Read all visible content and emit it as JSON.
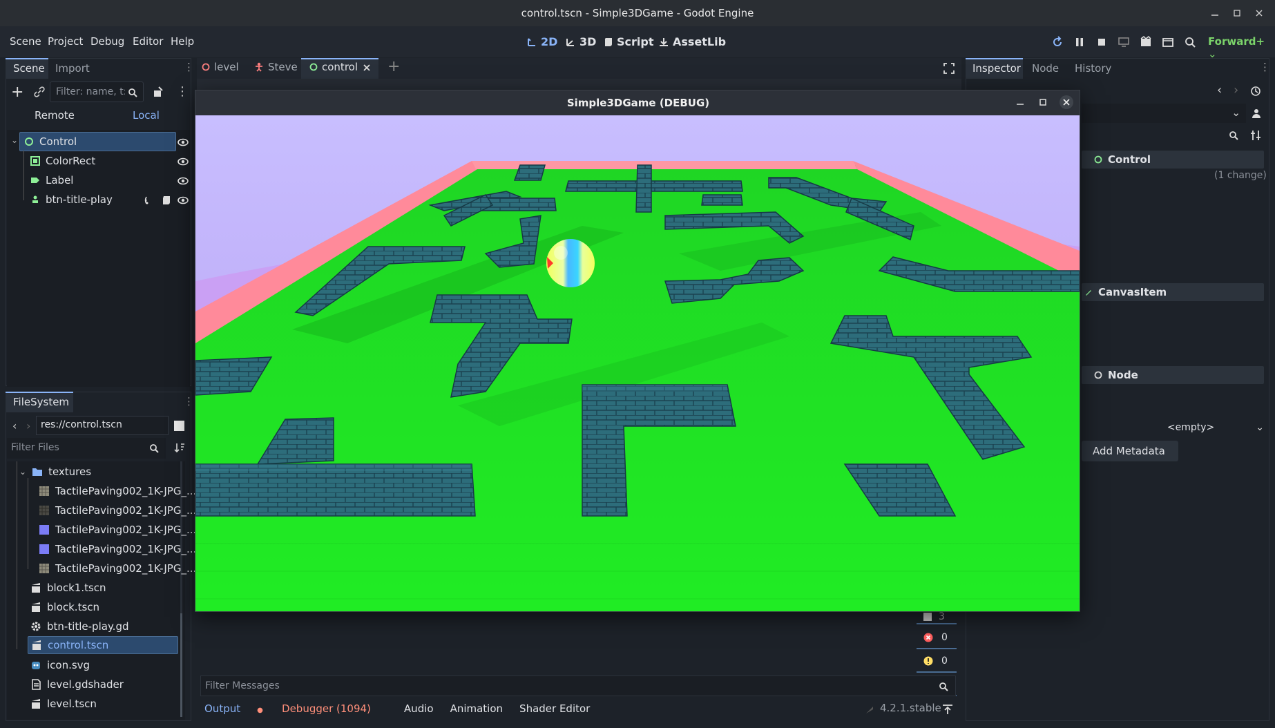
{
  "window": {
    "title": "control.tscn - Simple3DGame - Godot Engine"
  },
  "menu": [
    "Scene",
    "Project",
    "Debug",
    "Editor",
    "Help"
  ],
  "workspaces": [
    {
      "label": "2D",
      "icon": "2d-icon",
      "active": true
    },
    {
      "label": "3D",
      "icon": "3d-icon"
    },
    {
      "label": "Script",
      "icon": "script-icon"
    },
    {
      "label": "AssetLib",
      "icon": "assetlib-icon"
    }
  ],
  "renderer": "Forward+",
  "scene_dock": {
    "tabs": [
      "Scene",
      "Import"
    ],
    "filter_placeholder": "Filter: name, t:t",
    "remote": "Remote",
    "local": "Local",
    "nodes": [
      {
        "label": "Control",
        "icon": "control-icon",
        "selected": true
      },
      {
        "label": "ColorRect",
        "icon": "colorrect-icon"
      },
      {
        "label": "Label",
        "icon": "label-icon"
      },
      {
        "label": "btn-title-play",
        "icon": "button-icon"
      }
    ]
  },
  "filesystem": {
    "tab": "FileSystem",
    "path": "res://control.tscn",
    "filter_placeholder": "Filter Files",
    "items": [
      {
        "label": "textures",
        "type": "folder"
      },
      {
        "label": "TactilePaving002_1K-JPG_...",
        "type": "texture"
      },
      {
        "label": "TactilePaving002_1K-JPG_...",
        "type": "texture"
      },
      {
        "label": "TactilePaving002_1K-JPG_...",
        "type": "texture-blue"
      },
      {
        "label": "TactilePaving002_1K-JPG_...",
        "type": "texture-blue"
      },
      {
        "label": "TactilePaving002_1K-JPG_...",
        "type": "texture"
      },
      {
        "label": "block1.tscn",
        "type": "scene"
      },
      {
        "label": "block.tscn",
        "type": "scene"
      },
      {
        "label": "btn-title-play.gd",
        "type": "script"
      },
      {
        "label": "control.tscn",
        "type": "scene",
        "selected": true
      },
      {
        "label": "icon.svg",
        "type": "svg"
      },
      {
        "label": "level.gdshader",
        "type": "shader"
      },
      {
        "label": "level.tscn",
        "type": "scene"
      }
    ]
  },
  "editor_tabs": [
    {
      "label": "level"
    },
    {
      "label": "Steve"
    },
    {
      "label": "control",
      "active": true
    }
  ],
  "game_window": {
    "title": "Simple3DGame (DEBUG)"
  },
  "inspector": {
    "tabs": [
      "Inspector",
      "Node",
      "History"
    ],
    "node_name": "Control",
    "change_note": "(1 change)",
    "sections": [
      "CanvasItem",
      "Node"
    ],
    "metadata_value": "<empty>",
    "add_metadata": "Add Metadata"
  },
  "bottom": {
    "filter_placeholder": "Filter Messages",
    "tabs": [
      "Output",
      "Debugger (1094)",
      "Audio",
      "Animation",
      "Shader Editor"
    ],
    "version": "4.2.1.stable",
    "counters": [
      "3",
      "0",
      "0",
      "0"
    ]
  },
  "colors": {
    "accent": "#8ab4f8",
    "selection": "#2c4a6e",
    "floor": "#22e02a",
    "wall": "#ff8a9a",
    "sky": "#c0b7ff",
    "block": "#2f6b7a"
  }
}
